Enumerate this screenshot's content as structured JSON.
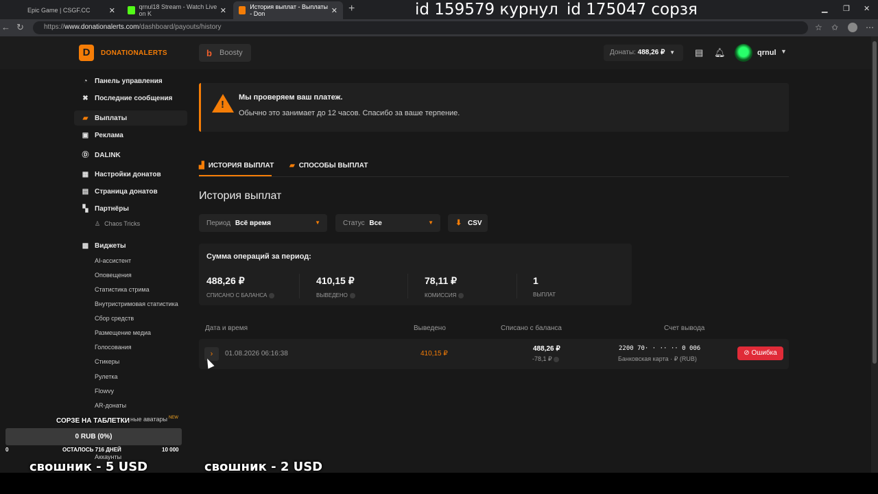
{
  "browser": {
    "tabs": [
      {
        "title": "Epic Game | CSGF.CC",
        "close": "✕"
      },
      {
        "title": "qrnul18 Stream - Watch Live on K",
        "close": "✕"
      },
      {
        "title": "История выплат - Выплаты - Don",
        "close": "✕"
      }
    ],
    "new_tab": "+",
    "url_prefix": "https://",
    "url_host": "www.donationalerts.com",
    "url_path": "/dashboard/payouts/history"
  },
  "stream_overlay": {
    "id_left": "id 159579 курнул",
    "id_right": "id 175047 сорзя",
    "goal_title": "СОРЗЕ НА ТАБЛЕТКИ",
    "goal_progress": "0 RUB (0%)",
    "goal_progress_fraction": 0,
    "goal_min": "0",
    "goal_remaining": "ОСТАЛОСЬ 716 ДНЕЙ",
    "goal_max": "10 000",
    "donor_1": "свошник - 5 USD",
    "donor_2": "свошник - 2 USD"
  },
  "header": {
    "logo_text": "DONATIONALERTS",
    "boosty_label": "Boosty",
    "donats_label": "Донаты:",
    "donats_value": "488,26 ₽",
    "username": "qrnul"
  },
  "sidebar": {
    "items": [
      {
        "label": "Панель управления",
        "icon": "dashboard-icon"
      },
      {
        "label": "Последние сообщения",
        "icon": "messages-icon"
      },
      {
        "label": "Выплаты",
        "icon": "wallet-icon"
      },
      {
        "label": "Реклама",
        "icon": "ads-icon"
      },
      {
        "label": "DALINK",
        "icon": "dalink-icon"
      },
      {
        "label": "Настройки донатов",
        "icon": "settings-icon"
      },
      {
        "label": "Страница донатов",
        "icon": "page-icon"
      },
      {
        "label": "Партнёры",
        "icon": "partners-icon"
      },
      {
        "label": "Виджеты",
        "icon": "widgets-icon"
      }
    ],
    "partner_sub": "Chaos Tricks",
    "widgets": [
      "AI-ассистент",
      "Оповещения",
      "Статистика стрима",
      "Внутристримовая статистика",
      "Сбор средств",
      "Размещение медиа",
      "Голосования",
      "Стикеры",
      "Рулетка",
      "Flowvy",
      "AR-донаты"
    ],
    "avatars_partial": "ные аватары",
    "avatars_new": "NEW",
    "accounts": "Аккаунты"
  },
  "alert": {
    "title": "Мы проверяем ваш платеж.",
    "text": "Обычно это занимает до 12 часов. Спасибо за ваше терпение."
  },
  "page_tabs": {
    "history": "ИСТОРИЯ ВЫПЛАТ",
    "methods": "СПОСОБЫ ВЫПЛАТ"
  },
  "page_title": "История выплат",
  "filters": {
    "period_label": "Период",
    "period_value": "Всё время",
    "status_label": "Статус",
    "status_value": "Все",
    "csv_label": "CSV"
  },
  "summary": {
    "title": "Сумма операций за период:",
    "stats": [
      {
        "value": "488,26 ₽",
        "caption": "СПИСАНО С БАЛАНСА"
      },
      {
        "value": "410,15 ₽",
        "caption": "ВЫВЕДЕНО"
      },
      {
        "value": "78,11 ₽",
        "caption": "КОМИССИЯ"
      },
      {
        "value": "1",
        "caption": "ВЫПЛАТ"
      }
    ]
  },
  "table": {
    "headers": {
      "date": "Дата и время",
      "withdrawn": "Выведено",
      "debited": "Списано с баланса",
      "account": "Счет вывода"
    },
    "rows": [
      {
        "date": "01.08.2026 06:16:38",
        "withdrawn": "410,15 ₽",
        "debited": "488,26 ₽",
        "fee": "-78,1 ₽",
        "account_number": "2200 70· · ·· ·· 0 006",
        "account_type": "Банковская карта · ₽ (RUB)",
        "status": "Ошибка"
      }
    ]
  },
  "colors": {
    "accent": "#f57d07",
    "error": "#e02b38",
    "background": "#181818"
  }
}
